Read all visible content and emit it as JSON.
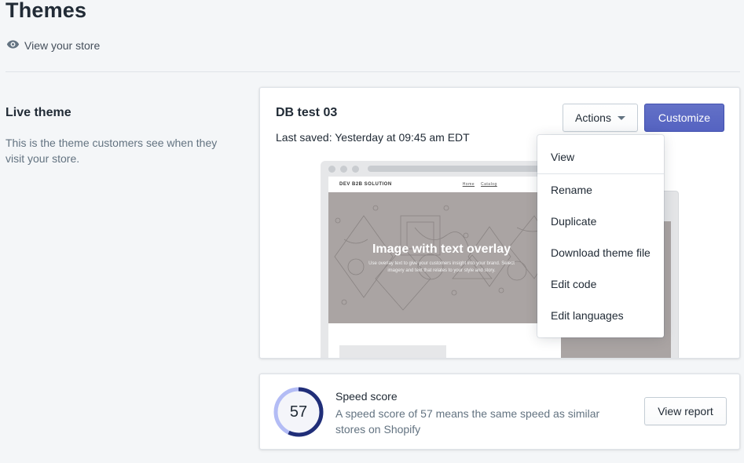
{
  "page": {
    "title": "Themes",
    "view_store_label": "View your store"
  },
  "live_theme": {
    "section_title": "Live theme",
    "section_description": "This is the theme customers see when they visit your store."
  },
  "theme_card": {
    "name": "DB test 03",
    "last_saved": "Last saved: Yesterday at 09:45 am EDT",
    "actions_label": "Actions",
    "customize_label": "Customize",
    "preview": {
      "store_name": "DEV B2B SOLUTION",
      "nav_items": [
        "Home",
        "Catalog"
      ],
      "hero_title": "Image with text overlay",
      "hero_subtitle": "Use overlay text to give your customers insight into your brand. Select imagery and text that relates to your style and story."
    }
  },
  "actions_menu": {
    "items": [
      "View",
      "Rename",
      "Duplicate",
      "Download theme file",
      "Edit code",
      "Edit languages"
    ]
  },
  "speed_card": {
    "score": "57",
    "score_fraction": 0.57,
    "title": "Speed score",
    "description": "A speed score of 57 means the same speed as similar stores on Shopify",
    "view_report_label": "View report"
  },
  "colors": {
    "primary": "#5c6ac4",
    "background": "#f4f6f8",
    "text": "#212b36",
    "subdued_text": "#637381",
    "gauge_dark": "#202e78",
    "gauge_light": "#b3bcf5"
  },
  "icons": {
    "view_store": "eye-icon",
    "actions_caret": "caret-down-icon"
  }
}
